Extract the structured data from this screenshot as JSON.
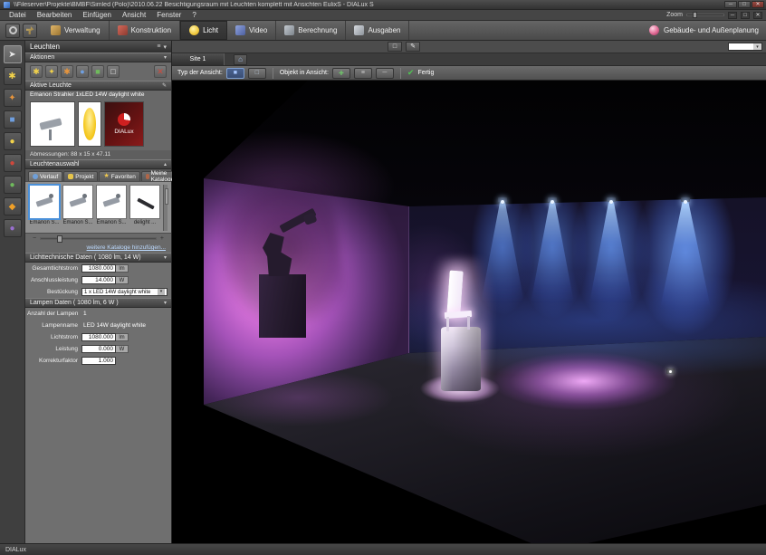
{
  "window": {
    "title": "\\\\Fileserver\\Projekte\\BMBF\\Simled (Polo)\\2010.06.22 Besichtigungsraum mit Leuchten komplett mit Ansichten EulixS - DIALux S"
  },
  "menubar": {
    "items": [
      "Datei",
      "Bearbeiten",
      "Einfügen",
      "Ansicht",
      "Fenster",
      "?"
    ],
    "zoom_label": "Zoom"
  },
  "ribbon": {
    "tabs": [
      {
        "label": "Verwaltung"
      },
      {
        "label": "Konstruktion"
      },
      {
        "label": "Licht"
      },
      {
        "label": "Video"
      },
      {
        "label": "Berechnung"
      },
      {
        "label": "Ausgaben"
      }
    ],
    "active_tab": "Licht",
    "right_label": "Gebäude- und Außenplanung"
  },
  "viewbar": {
    "site_tab": "Site 1",
    "type_label": "Typ der Ansicht:",
    "object_label": "Objekt in Ansicht:",
    "done_label": "Fertig"
  },
  "sidebar": {
    "panel_title": "Leuchten",
    "sections": {
      "aktionen": "Aktionen",
      "aktive_leuchte": "Aktive Leuchte",
      "leuchtenauswahl": "Leuchtenauswahl",
      "licht_daten": "Lichttechnische Daten ( 1080 lm, 14 W)",
      "lampen_daten": "Lampen Daten ( 1080 lm, 6 W )"
    },
    "active_luminaire": {
      "name": "Emanon Strahler 1xLED 14W daylight white",
      "logo_text": "DIALux",
      "dimensions": "Abmessungen:  88 x 15 x 47.11"
    },
    "catalog_tabs": [
      "Verlauf",
      "Projekt",
      "Favoriten",
      "Meine Kataloge"
    ],
    "thumbnails": [
      "Emanon S...",
      "Emanon S...",
      "Emanon S...",
      "delight ..."
    ],
    "more_link": "weitere Kataloge hinzufügen...",
    "fields": {
      "gesamtlichtstrom": {
        "label": "Gesamtlichtstrom",
        "value": "1080.000",
        "unit": "lm"
      },
      "anschlussleistung": {
        "label": "Anschlussleistung",
        "value": "14.000",
        "unit": "W"
      },
      "bestueckung": {
        "label": "Bestückung",
        "value": "1 x LED 14W daylight white"
      },
      "anzahl": {
        "label": "Anzahl der Lampen",
        "value": "1"
      },
      "lampenname": {
        "label": "Lampenname",
        "value": "LED 14W daylight white"
      },
      "lichtstrom": {
        "label": "Lichtstrom",
        "value": "1080.000",
        "unit": "lm"
      },
      "leistung": {
        "label": "Leistung",
        "value": "0.000",
        "unit": "W"
      },
      "korrekturfaktor": {
        "label": "Korrekturfaktor",
        "value": "1.000"
      }
    }
  },
  "statusbar": {
    "app_name": "DIALux"
  },
  "colors": {
    "accent_blue": "#6fa0ff",
    "magenta_light": "#f095ee",
    "panel_gray": "#6f6f6f",
    "done_green": "#4ec452"
  }
}
